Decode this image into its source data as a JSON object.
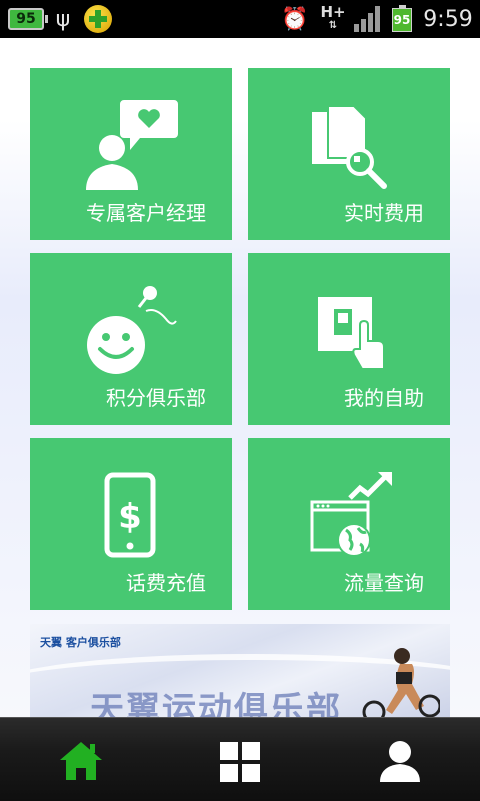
{
  "status_bar": {
    "battery_left": "95",
    "network": "H+",
    "battery_right": "95",
    "time": "9:59"
  },
  "tiles": [
    {
      "label": "专属客户经理",
      "icon": "customer-manager-icon"
    },
    {
      "label": "实时费用",
      "icon": "bill-search-icon"
    },
    {
      "label": "积分俱乐部",
      "icon": "smiley-microphone-icon"
    },
    {
      "label": "我的自助",
      "icon": "switch-touch-icon"
    },
    {
      "label": "话费充值",
      "icon": "phone-dollar-icon"
    },
    {
      "label": "流量查询",
      "icon": "browser-globe-trend-icon"
    }
  ],
  "banner": {
    "logo_text": "天翼 客户俱乐部",
    "title": "天翼运动俱乐部"
  },
  "bottom_nav": [
    {
      "name": "home",
      "icon": "home-icon",
      "active": true
    },
    {
      "name": "apps",
      "icon": "grid-icon",
      "active": false
    },
    {
      "name": "profile",
      "icon": "user-icon",
      "active": false
    }
  ],
  "colors": {
    "tile_green": "#47c872",
    "nav_active": "#22b022",
    "nav_bg": "#1a1a1a"
  }
}
